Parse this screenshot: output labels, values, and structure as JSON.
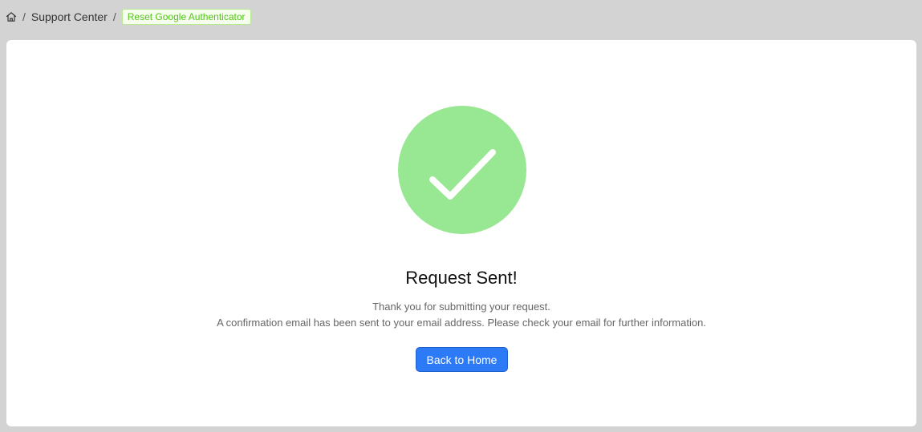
{
  "breadcrumb": {
    "home_icon": "home-icon",
    "separator": "/",
    "parent": "Support Center",
    "current": "Reset Google Authenticator"
  },
  "result": {
    "status_icon": "check-icon",
    "status_color": "#98e792",
    "title": "Request Sent!",
    "line1": "Thank you for submitting your request.",
    "line2": "A confirmation email has been sent to your email address. Please check your email for further information.",
    "button_label": "Back to Home",
    "button_color": "#2d7af6"
  }
}
